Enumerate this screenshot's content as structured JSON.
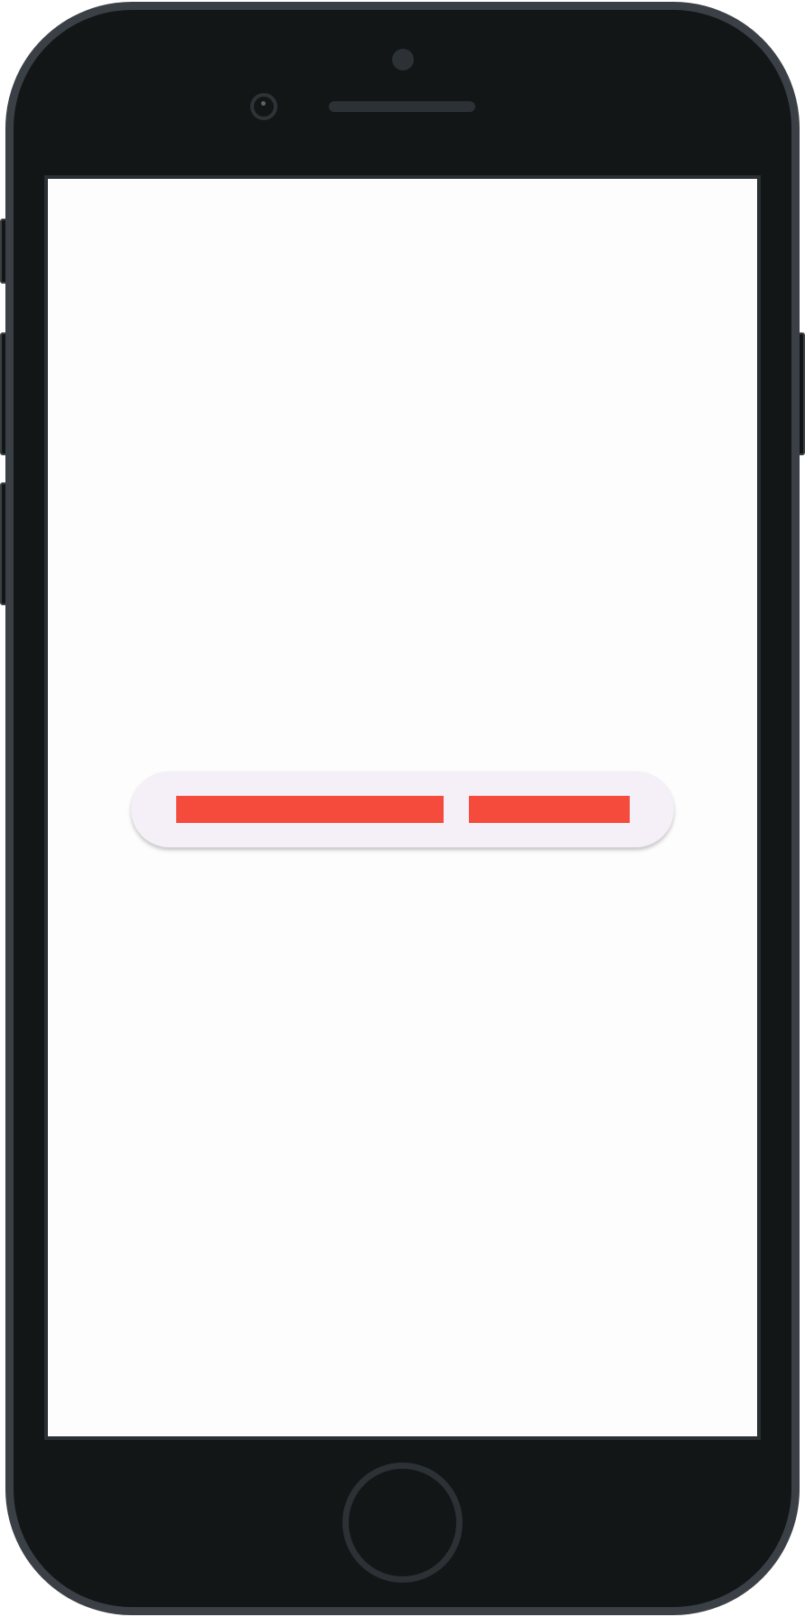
{
  "device": {
    "frame_color": "#121617",
    "bezel_outline_color": "#3a4045",
    "screen_background": "#fdfdfd"
  },
  "screen": {
    "button_bar": {
      "background": "#f5eff7",
      "buttons": [
        {
          "label": "",
          "color": "#f44b3c"
        },
        {
          "label": "",
          "color": "#f44b3c"
        }
      ]
    }
  },
  "icons": {
    "home": "home-button-icon",
    "camera": "front-camera-icon",
    "speaker": "earpiece-speaker-icon",
    "sensor": "proximity-sensor-icon"
  }
}
